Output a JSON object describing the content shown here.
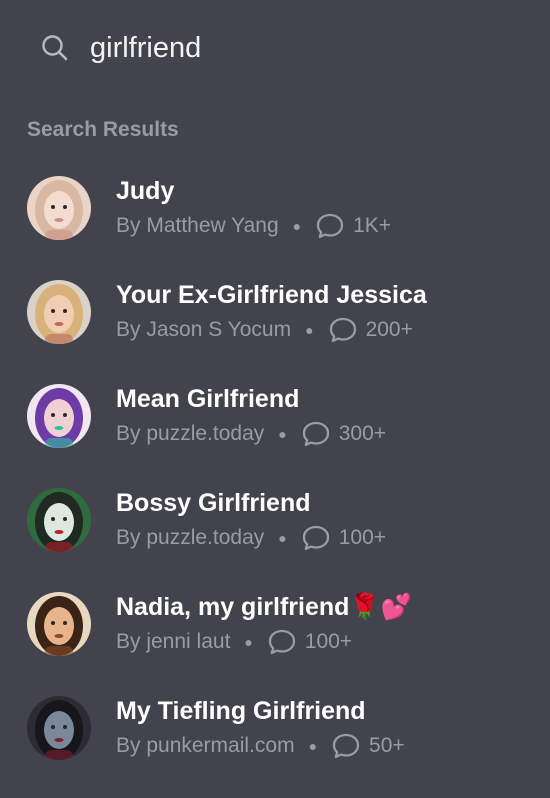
{
  "search": {
    "value": "girlfriend",
    "icon": "search-icon"
  },
  "section": {
    "title": "Search Results"
  },
  "results": [
    {
      "name": "Judy",
      "author": "By Matthew Yang",
      "count": "1K+",
      "avatar_colors": {
        "bg": "#e9d4c7",
        "hair": "#d9b8a3",
        "skin": "#f4ddd0",
        "accent": "#c98f86"
      }
    },
    {
      "name": "Your Ex-Girlfriend Jessica",
      "author": "By Jason S Yocum",
      "count": "200+",
      "avatar_colors": {
        "bg": "#d8d2c8",
        "hair": "#d8b27a",
        "skin": "#f0cdb3",
        "accent": "#b76e62"
      }
    },
    {
      "name": "Mean Girlfriend",
      "author": "By puzzle.today",
      "count": "300+",
      "avatar_colors": {
        "bg": "#f2e7ef",
        "hair": "#6d3aa6",
        "skin": "#f1d0d4",
        "accent": "#2fbfa0"
      }
    },
    {
      "name": "Bossy Girlfriend",
      "author": "By puzzle.today",
      "count": "100+",
      "avatar_colors": {
        "bg": "#2f6b3f",
        "hair": "#1f2a22",
        "skin": "#dfe8df",
        "accent": "#b3202a"
      }
    },
    {
      "name": "Nadia, my girlfriend🌹💕",
      "author": "By jenni laut",
      "count": "100+",
      "avatar_colors": {
        "bg": "#e8d8bf",
        "hair": "#3a2418",
        "skin": "#e7b48c",
        "accent": "#8c4a2c"
      }
    },
    {
      "name": "My Tiefling Girlfriend",
      "author": "By punkermail.com",
      "count": "50+",
      "avatar_colors": {
        "bg": "#2d2a33",
        "hair": "#17161b",
        "skin": "#7a8899",
        "accent": "#7a2030"
      }
    }
  ]
}
